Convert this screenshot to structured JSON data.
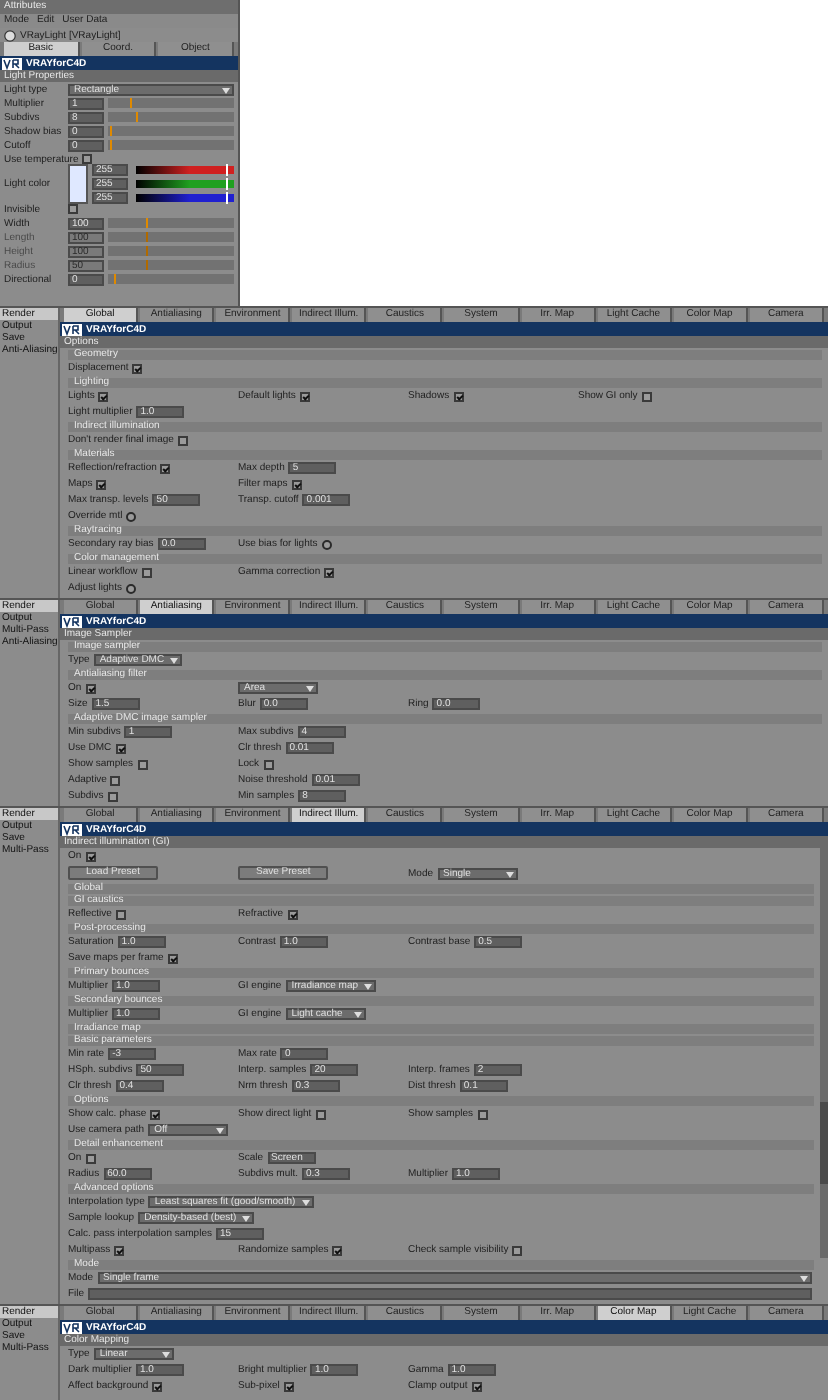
{
  "attributes": {
    "title": "Attributes",
    "menu": [
      "Mode",
      "Edit",
      "User Data"
    ],
    "object": "VRayLight [VRayLight]",
    "tabs": [
      {
        "label": "Basic",
        "selected": true
      },
      {
        "label": "Coord.",
        "selected": false
      },
      {
        "label": "Object",
        "selected": false
      }
    ],
    "header": "VRAYforC4D",
    "section": "Light Properties",
    "rows": [
      {
        "kind": "select",
        "label": "Light type",
        "value": "Rectangle"
      },
      {
        "kind": "slider",
        "label": "Multiplier",
        "value": "1",
        "level": 0.18
      },
      {
        "kind": "slider",
        "label": "Subdivs",
        "value": "8",
        "level": 0.22
      },
      {
        "kind": "slider",
        "label": "Shadow bias",
        "value": "0",
        "level": 0.02
      },
      {
        "kind": "slider",
        "label": "Cutoff",
        "value": "0",
        "level": 0.02
      },
      {
        "kind": "check",
        "label": "Use temperature",
        "checked": false
      },
      {
        "kind": "color",
        "label": "Light color",
        "channels": [
          {
            "value": "255",
            "level": 0.92,
            "color": "#d02020"
          },
          {
            "value": "255",
            "level": 0.92,
            "color": "#20a020"
          },
          {
            "value": "255",
            "level": 0.92,
            "color": "#2020d0"
          }
        ]
      },
      {
        "kind": "check",
        "label": "Invisible",
        "checked": false
      },
      {
        "kind": "slider",
        "label": "Width",
        "value": "100",
        "level": 0.3
      },
      {
        "kind": "slider",
        "label": "Length",
        "value": "100",
        "level": 0.3,
        "disabled": true
      },
      {
        "kind": "slider",
        "label": "Height",
        "value": "100",
        "level": 0.3,
        "disabled": true
      },
      {
        "kind": "slider",
        "label": "Radius",
        "value": "50",
        "level": 0.3,
        "disabled": true
      },
      {
        "kind": "slider",
        "label": "Directional",
        "value": "0",
        "level": 0.04
      }
    ]
  },
  "panels": [
    {
      "sidebar": [
        {
          "label": "Render",
          "selected": true
        },
        {
          "label": "Output",
          "selected": false
        },
        {
          "label": "Save",
          "selected": false
        },
        {
          "label": "Anti-Aliasing",
          "selected": false
        }
      ],
      "tabs": [
        {
          "label": "Global",
          "selected": true
        },
        {
          "label": "Antialiasing",
          "selected": false
        },
        {
          "label": "Environment",
          "selected": false
        },
        {
          "label": "Indirect Illum.",
          "selected": false
        },
        {
          "label": "Caustics",
          "selected": false
        },
        {
          "label": "System",
          "selected": false
        },
        {
          "label": "Irr. Map",
          "selected": false
        },
        {
          "label": "Light Cache",
          "selected": false
        },
        {
          "label": "Color Map",
          "selected": false
        },
        {
          "label": "Camera",
          "selected": false
        }
      ],
      "header": "VRAYforC4D",
      "section": "Options",
      "groups": [
        {
          "title": "Geometry",
          "rows": [
            [
              {
                "kind": "check",
                "label": "Displacement",
                "checked": true
              }
            ]
          ]
        },
        {
          "title": "Lighting",
          "rows": [
            [
              {
                "kind": "check",
                "label": "Lights",
                "checked": true
              },
              {
                "kind": "check",
                "label": "Default lights",
                "checked": true
              },
              {
                "kind": "check",
                "label": "Shadows",
                "checked": true
              },
              {
                "kind": "check",
                "label": "Show GI only",
                "checked": false
              }
            ],
            [
              {
                "kind": "field",
                "label": "Light multiplier",
                "value": "1.0"
              }
            ]
          ]
        },
        {
          "title": "Indirect illumination",
          "rows": [
            [
              {
                "kind": "check",
                "label": "Don't render final image",
                "checked": false
              }
            ]
          ]
        },
        {
          "title": "Materials",
          "rows": [
            [
              {
                "kind": "check",
                "label": "Reflection/refraction",
                "checked": true
              },
              {
                "kind": "field",
                "label": "Max depth",
                "value": "5"
              }
            ],
            [
              {
                "kind": "check",
                "label": "Maps",
                "checked": true
              },
              {
                "kind": "check",
                "label": "Filter maps",
                "checked": true
              }
            ],
            [
              {
                "kind": "field",
                "label": "Max transp. levels",
                "value": "50"
              },
              {
                "kind": "field",
                "label": "Transp. cutoff",
                "value": "0.001"
              }
            ],
            [
              {
                "kind": "radio",
                "label": "Override mtl",
                "on": false
              }
            ]
          ]
        },
        {
          "title": "Raytracing",
          "rows": [
            [
              {
                "kind": "field",
                "label": "Secondary ray bias",
                "value": "0.0"
              },
              {
                "kind": "radio",
                "label": "Use bias for lights",
                "on": false
              }
            ]
          ]
        },
        {
          "title": "Color management",
          "rows": [
            [
              {
                "kind": "check",
                "label": "Linear workflow",
                "checked": false
              },
              {
                "kind": "check",
                "label": "Gamma correction",
                "checked": true
              }
            ],
            [
              {
                "kind": "radio",
                "label": "Adjust lights",
                "on": false
              }
            ]
          ]
        }
      ]
    },
    {
      "sidebar": [
        {
          "label": "Render",
          "selected": true
        },
        {
          "label": "Output",
          "selected": false
        },
        {
          "label": "Multi-Pass",
          "selected": false
        },
        {
          "label": "Anti-Aliasing",
          "selected": false
        }
      ],
      "tabs": [
        {
          "label": "Global",
          "selected": false
        },
        {
          "label": "Antialiasing",
          "selected": true
        },
        {
          "label": "Environment",
          "selected": false
        },
        {
          "label": "Indirect Illum.",
          "selected": false
        },
        {
          "label": "Caustics",
          "selected": false
        },
        {
          "label": "System",
          "selected": false
        },
        {
          "label": "Irr. Map",
          "selected": false
        },
        {
          "label": "Light Cache",
          "selected": false
        },
        {
          "label": "Color Map",
          "selected": false
        },
        {
          "label": "Camera",
          "selected": false
        }
      ],
      "header": "VRAYforC4D",
      "section": "Image Sampler",
      "groups": [
        {
          "title": "Image sampler",
          "rows": [
            [
              {
                "kind": "select",
                "label": "Type",
                "value": "Adaptive DMC"
              }
            ]
          ]
        },
        {
          "title": "Antialiasing filter",
          "rows": [
            [
              {
                "kind": "check",
                "label": "On",
                "checked": true
              },
              {
                "kind": "select",
                "value": "Area"
              }
            ],
            [
              {
                "kind": "field",
                "label": "Size",
                "value": "1.5"
              },
              {
                "kind": "field",
                "label": "Blur",
                "value": "0.0"
              },
              {
                "kind": "field",
                "label": "Ring",
                "value": "0.0"
              }
            ]
          ]
        },
        {
          "title": "Adaptive DMC image sampler",
          "rows": [
            [
              {
                "kind": "field",
                "label": "Min subdivs",
                "value": "1"
              },
              {
                "kind": "field",
                "label": "Max subdivs",
                "value": "4"
              }
            ],
            [
              {
                "kind": "check",
                "label": "Use DMC",
                "checked": true
              },
              {
                "kind": "field",
                "label": "Clr thresh",
                "value": "0.01"
              }
            ],
            [
              {
                "kind": "check",
                "label": "Show samples",
                "checked": false
              },
              {
                "kind": "check",
                "label": "Lock",
                "checked": false
              }
            ],
            [
              {
                "kind": "check",
                "label": "Adaptive",
                "checked": false
              },
              {
                "kind": "field",
                "label": "Noise threshold",
                "value": "0.01"
              }
            ],
            [
              {
                "kind": "check",
                "label": "Subdivs",
                "checked": false
              },
              {
                "kind": "field",
                "label": "Min samples",
                "value": "8"
              }
            ]
          ]
        }
      ]
    },
    {
      "sidebar": [
        {
          "label": "Render",
          "selected": true
        },
        {
          "label": "Output",
          "selected": false
        },
        {
          "label": "Save",
          "selected": false
        },
        {
          "label": "Multi-Pass",
          "selected": false
        }
      ],
      "tabs": [
        {
          "label": "Global",
          "selected": false
        },
        {
          "label": "Antialiasing",
          "selected": false
        },
        {
          "label": "Environment",
          "selected": false
        },
        {
          "label": "Indirect Illum.",
          "selected": true
        },
        {
          "label": "Caustics",
          "selected": false
        },
        {
          "label": "System",
          "selected": false
        },
        {
          "label": "Irr. Map",
          "selected": false
        },
        {
          "label": "Light Cache",
          "selected": false
        },
        {
          "label": "Color Map",
          "selected": false
        },
        {
          "label": "Camera",
          "selected": false
        }
      ],
      "header": "VRAYforC4D",
      "section": "Indirect illumination (GI)",
      "groups": [
        {
          "rows": [
            [
              {
                "kind": "check",
                "label": "On",
                "checked": true
              }
            ],
            [
              {
                "kind": "button",
                "label": "Load Preset"
              },
              {
                "kind": "button",
                "label": "Save Preset"
              },
              {
                "kind": "select",
                "label": "Mode",
                "value": "Single"
              }
            ]
          ]
        },
        {
          "title": "Global"
        },
        {
          "title": "GI caustics",
          "rows": [
            [
              {
                "kind": "check",
                "label": "Reflective",
                "checked": false
              },
              {
                "kind": "check",
                "label": "Refractive",
                "checked": true
              }
            ]
          ]
        },
        {
          "title": "Post-processing",
          "rows": [
            [
              {
                "kind": "field",
                "label": "Saturation",
                "value": "1.0"
              },
              {
                "kind": "field",
                "label": "Contrast",
                "value": "1.0"
              },
              {
                "kind": "field",
                "label": "Contrast base",
                "value": "0.5"
              }
            ],
            [
              {
                "kind": "check",
                "label": "Save maps per frame",
                "checked": true
              }
            ]
          ]
        },
        {
          "title": "Primary bounces",
          "rows": [
            [
              {
                "kind": "field",
                "label": "Multiplier",
                "value": "1.0"
              },
              {
                "kind": "select",
                "label": "GI engine",
                "value": "Irradiance map"
              }
            ]
          ]
        },
        {
          "title": "Secondary bounces",
          "rows": [
            [
              {
                "kind": "field",
                "label": "Multiplier",
                "value": "1.0"
              },
              {
                "kind": "select",
                "label": "GI engine",
                "value": "Light cache"
              }
            ]
          ]
        },
        {
          "title": "Irradiance map"
        },
        {
          "title": "Basic parameters",
          "rows": [
            [
              {
                "kind": "field",
                "label": "Min rate",
                "value": "-3"
              },
              {
                "kind": "field",
                "label": "Max rate",
                "value": "0"
              }
            ],
            [
              {
                "kind": "field",
                "label": "HSph. subdivs",
                "value": "50"
              },
              {
                "kind": "field",
                "label": "Interp. samples",
                "value": "20"
              },
              {
                "kind": "field",
                "label": "Interp. frames",
                "value": "2"
              }
            ],
            [
              {
                "kind": "field",
                "label": "Clr thresh",
                "value": "0.4"
              },
              {
                "kind": "field",
                "label": "Nrm thresh",
                "value": "0.3"
              },
              {
                "kind": "field",
                "label": "Dist thresh",
                "value": "0.1"
              }
            ]
          ]
        },
        {
          "title": "Options",
          "rows": [
            [
              {
                "kind": "check",
                "label": "Show calc. phase",
                "checked": true
              },
              {
                "kind": "check",
                "label": "Show direct light",
                "checked": false
              },
              {
                "kind": "check",
                "label": "Show samples",
                "checked": false
              }
            ],
            [
              {
                "kind": "select",
                "label": "Use camera path",
                "value": "Off"
              }
            ]
          ]
        },
        {
          "title": "Detail enhancement",
          "rows": [
            [
              {
                "kind": "check",
                "label": "On",
                "checked": false
              },
              {
                "kind": "field",
                "label": "Scale",
                "value": "Screen"
              }
            ],
            [
              {
                "kind": "field",
                "label": "Radius",
                "value": "60.0"
              },
              {
                "kind": "field",
                "label": "Subdivs mult.",
                "value": "0.3"
              },
              {
                "kind": "field",
                "label": "Multiplier",
                "value": "1.0"
              }
            ]
          ]
        },
        {
          "title": "Advanced options",
          "rows": [
            [
              {
                "kind": "select",
                "label": "Interpolation type",
                "value": "Least squares fit (good/smooth)"
              }
            ],
            [
              {
                "kind": "select",
                "label": "Sample lookup",
                "value": "Density-based (best)"
              }
            ],
            [
              {
                "kind": "field",
                "label": "Calc. pass interpolation samples",
                "value": "15"
              }
            ],
            [
              {
                "kind": "check",
                "label": "Multipass",
                "checked": true
              },
              {
                "kind": "check",
                "label": "Randomize samples",
                "checked": true
              },
              {
                "kind": "check",
                "label": "Check sample visibility",
                "checked": false
              }
            ]
          ]
        },
        {
          "title": "Mode",
          "rows": [
            [
              {
                "kind": "longselect",
                "label": "Mode",
                "value": "Single frame"
              }
            ],
            [
              {
                "kind": "longfield",
                "label": "File"
              }
            ]
          ]
        }
      ]
    },
    {
      "sidebar": [
        {
          "label": "Render",
          "selected": true
        },
        {
          "label": "Output",
          "selected": false
        },
        {
          "label": "Save",
          "selected": false
        },
        {
          "label": "Multi-Pass",
          "selected": false
        }
      ],
      "tabs": [
        {
          "label": "Global",
          "selected": false
        },
        {
          "label": "Antialiasing",
          "selected": false
        },
        {
          "label": "Environment",
          "selected": false
        },
        {
          "label": "Indirect Illum.",
          "selected": false
        },
        {
          "label": "Caustics",
          "selected": false
        },
        {
          "label": "System",
          "selected": false
        },
        {
          "label": "Irr. Map",
          "selected": false
        },
        {
          "label": "Color Map",
          "selected": true
        },
        {
          "label": "Light Cache",
          "selected": false
        },
        {
          "label": "Camera",
          "selected": false
        }
      ],
      "header": "VRAYforC4D",
      "section": "Color Mapping",
      "groups": [
        {
          "rows": [
            [
              {
                "kind": "select",
                "label": "Type",
                "value": "Linear"
              }
            ],
            [
              {
                "kind": "field",
                "label": "Dark multiplier",
                "value": "1.0"
              },
              {
                "kind": "field",
                "label": "Bright multiplier",
                "value": "1.0"
              },
              {
                "kind": "field",
                "label": "Gamma",
                "value": "1.0"
              }
            ],
            [
              {
                "kind": "check",
                "label": "Affect background",
                "checked": true
              },
              {
                "kind": "check",
                "label": "Sub-pixel",
                "checked": true
              },
              {
                "kind": "check",
                "label": "Clamp output",
                "checked": true
              }
            ]
          ]
        }
      ]
    }
  ]
}
